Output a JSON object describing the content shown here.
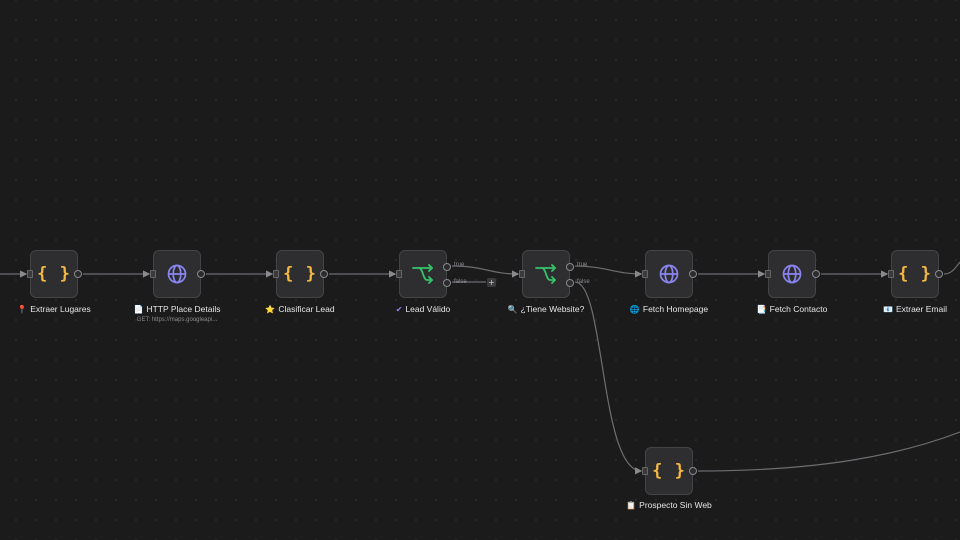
{
  "workflow": {
    "nodes": [
      {
        "id": "extraer-lugares",
        "label": "Extraer Lugares",
        "icon": "map-pin-icon",
        "icon_char": "📍",
        "type": "code",
        "subtitle": ""
      },
      {
        "id": "http-place-details",
        "label": "HTTP Place Details",
        "icon": "document-icon",
        "icon_char": "📄",
        "type": "http",
        "subtitle": "GET: https://maps.googleapi..."
      },
      {
        "id": "clasificar-lead",
        "label": "Clasificar Lead",
        "icon": "star-icon",
        "icon_char": "⭐",
        "type": "code",
        "subtitle": ""
      },
      {
        "id": "lead-valido",
        "label": "Lead Válido",
        "icon": "check-icon",
        "icon_char": "✔",
        "type": "if",
        "subtitle": "",
        "branches": [
          "true",
          "false"
        ]
      },
      {
        "id": "tiene-website",
        "label": "¿Tiene Website?",
        "icon": "magnifier-icon",
        "icon_char": "🔍",
        "type": "if",
        "subtitle": "",
        "branches": [
          "true",
          "false"
        ]
      },
      {
        "id": "fetch-homepage",
        "label": "Fetch Homepage",
        "icon": "globe-icon",
        "icon_char": "🌐",
        "type": "http",
        "subtitle": ""
      },
      {
        "id": "fetch-contacto",
        "label": "Fetch Contacto",
        "icon": "document-icon",
        "icon_char": "📑",
        "type": "http",
        "subtitle": ""
      },
      {
        "id": "extraer-email",
        "label": "Extraer Email",
        "icon": "envelope-icon",
        "icon_char": "📧",
        "type": "code",
        "subtitle": ""
      },
      {
        "id": "prospecto-sin-web",
        "label": "Prospecto Sin Web",
        "icon": "clipboard-icon",
        "icon_char": "📋",
        "type": "code",
        "subtitle": ""
      }
    ],
    "add_button_label": "+",
    "colors": {
      "code_icon": "#f5b942",
      "http_icon": "#8b85f0",
      "if_icon": "#35c46a",
      "edge": "#6e6e72",
      "canvas": "#1b1b1c"
    }
  }
}
